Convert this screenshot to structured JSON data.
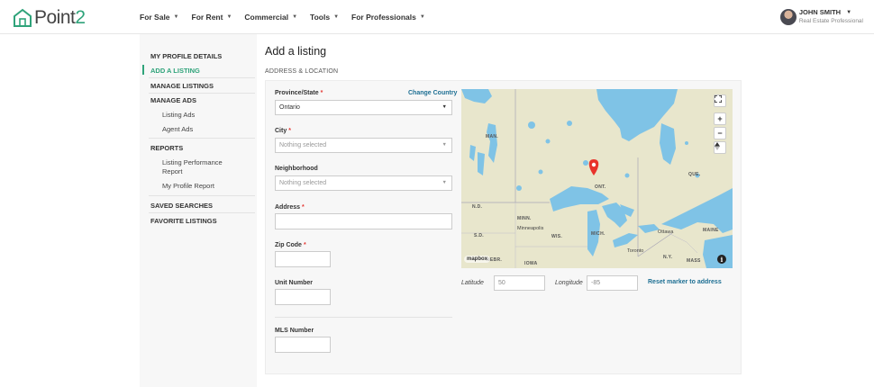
{
  "logo": {
    "text_main": "Point",
    "text_num": "2"
  },
  "nav": [
    {
      "label": "For Sale"
    },
    {
      "label": "For Rent"
    },
    {
      "label": "Commercial"
    },
    {
      "label": "Tools"
    },
    {
      "label": "For Professionals"
    }
  ],
  "user": {
    "name": "JOHN SMITH",
    "role": "Real Estate Professional"
  },
  "sidebar": {
    "my_profile": "MY PROFILE DETAILS",
    "add_listing": "ADD A LISTING",
    "manage_listings": "MANAGE LISTINGS",
    "manage_ads": "MANAGE ADS",
    "listing_ads": "Listing Ads",
    "agent_ads": "Agent Ads",
    "reports": "REPORTS",
    "listing_perf_1": "Listing Performance",
    "listing_perf_2": "Report",
    "profile_report": "My Profile Report",
    "saved_searches": "SAVED SEARCHES",
    "favorite_listings": "FAVORITE LISTINGS"
  },
  "main": {
    "title": "Add a listing",
    "section": "ADDRESS & LOCATION",
    "province_label": "Province/State",
    "province_value": "Ontario",
    "change_country": "Change Country",
    "city_label": "City",
    "city_placeholder": "Nothing selected",
    "neighborhood_label": "Neighborhood",
    "neighborhood_placeholder": "Nothing selected",
    "address_label": "Address",
    "zip_label": "Zip Code",
    "unit_label": "Unit Number",
    "mls_label": "MLS Number",
    "required_mark": "*"
  },
  "map": {
    "labels": {
      "man": "MAN.",
      "ont": "ONT.",
      "que": "QUE.",
      "nd": "N.D.",
      "minn": "MINN.",
      "wis": "WIS.",
      "mich": "MICH.",
      "sd": "S.D.",
      "nebr": "NEBR.",
      "iowa": "IOWA",
      "ny": "N.Y.",
      "mass": "MASS",
      "maine": "MAINE"
    },
    "cities": {
      "minneapolis": "Minneapolis",
      "ottawa": "Ottawa",
      "toronto": "Toronto"
    },
    "credit": "mapbox",
    "info": "i",
    "zoom_in": "+",
    "zoom_out": "−"
  },
  "coords": {
    "lat_label": "Latitude",
    "lat_value": "50",
    "lng_label": "Longitude",
    "lng_value": "-85",
    "reset": "Reset marker to address"
  }
}
